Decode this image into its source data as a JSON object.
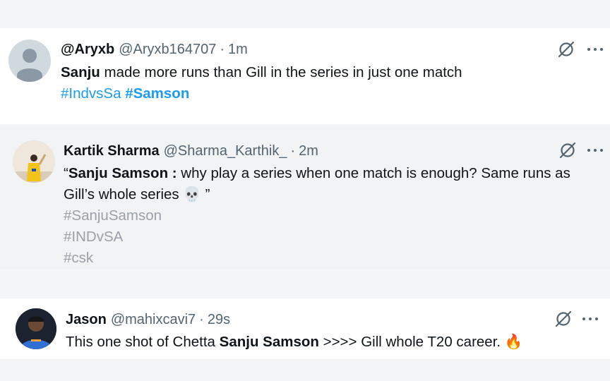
{
  "tweets": [
    {
      "name": "@Aryxb",
      "handle": "@Aryxb164707",
      "separator": "·",
      "time": "1m",
      "text": {
        "bold_start": "Sanju",
        "rest": " made more runs than Gill in the series in just one match"
      },
      "hashtags": [
        "#IndvsSa",
        "#Samson"
      ],
      "avatar_icon": "default-profile-icon"
    },
    {
      "name": "Kartik Sharma",
      "handle": "@Sharma_Karthik_",
      "separator": "·",
      "time": "2m",
      "text": {
        "open_quote": "“",
        "bold": "Sanju Samson :",
        "rest": " why play a series when one match is enough? Same runs as Gill’s whole series ",
        "emoji": "💀",
        "close_quote": " ”"
      },
      "hashtags": [
        "#SanjuSamson",
        "#INDvSA",
        "#csk"
      ],
      "avatar_icon": "cricketer-photo-avatar"
    },
    {
      "name": "Jason",
      "handle": "@mahixcavi7",
      "separator": "·",
      "time": "29s",
      "text": {
        "start": "This one shot of Chetta ",
        "bold": "Sanju Samson",
        "rest": " >>>> Gill whole T20 career. ",
        "emoji": "🔥"
      },
      "avatar_icon": "player-photo-avatar"
    }
  ],
  "colors": {
    "link": "#1d9bf0",
    "secondary_text": "#536471",
    "muted_hashtag": "#9aa1a8",
    "background": "#f4f5f6"
  },
  "icons": [
    "grok-icon",
    "more-options-icon"
  ]
}
